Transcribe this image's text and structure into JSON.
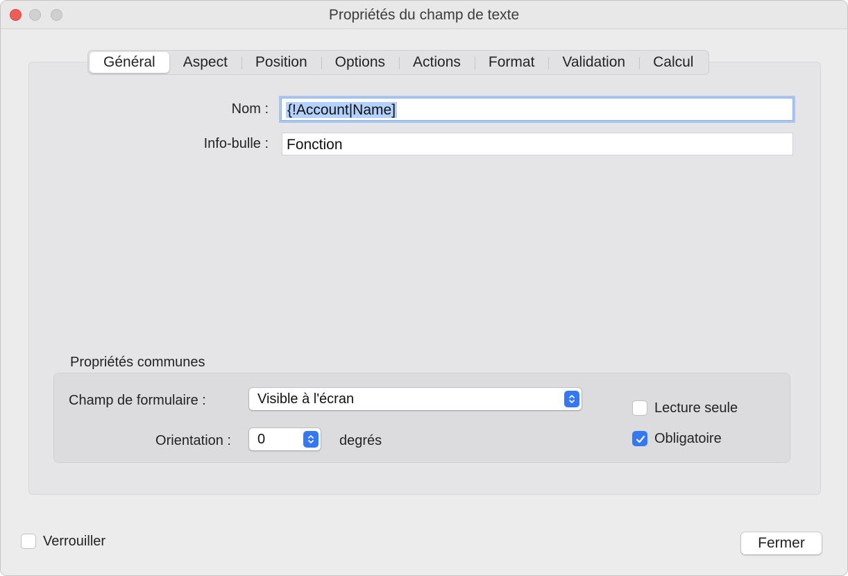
{
  "window": {
    "title": "Propriétés du champ de texte"
  },
  "tabs": [
    {
      "label": "Général",
      "active": true
    },
    {
      "label": "Aspect",
      "active": false
    },
    {
      "label": "Position",
      "active": false
    },
    {
      "label": "Options",
      "active": false
    },
    {
      "label": "Actions",
      "active": false
    },
    {
      "label": "Format",
      "active": false
    },
    {
      "label": "Validation",
      "active": false
    },
    {
      "label": "Calcul",
      "active": false
    }
  ],
  "general": {
    "name_label": "Nom :",
    "name_value": "{!Account|Name]",
    "tooltip_label": "Info-bulle :",
    "tooltip_value": "Fonction"
  },
  "common": {
    "section_label": "Propriétés communes",
    "form_field_label": "Champ de formulaire :",
    "form_field_value": "Visible à l'écran",
    "orientation_label": "Orientation :",
    "orientation_value": "0",
    "orientation_unit": "degrés",
    "readonly_label": "Lecture seule",
    "readonly_checked": false,
    "required_label": "Obligatoire",
    "required_checked": true
  },
  "footer": {
    "lock_label": "Verrouiller",
    "lock_checked": false,
    "close_label": "Fermer"
  },
  "colors": {
    "accent": "#3478f6",
    "selection": "#b3d1fb",
    "close_button": "#ee5d56"
  }
}
